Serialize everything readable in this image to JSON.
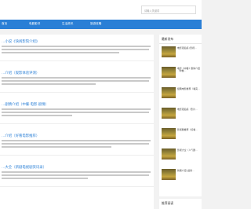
{
  "search": {
    "placeholder": "请输入关键词"
  },
  "nav": {
    "items": [
      "首页",
      "电影影评",
      "生活资讯",
      "旅游攻略"
    ]
  },
  "articles": [
    {
      "title": "…小说《快阅影院介绍》"
    },
    {
      "title": "…介绍（观影体验评测）"
    },
    {
      "title": "…剧情介绍（中餐·电影·剧情）"
    },
    {
      "title": "…介绍（好看电影推荐）"
    },
    {
      "title": "…大全（新剧电视剧资讯录）"
    }
  ],
  "sidebar": {
    "title": "最新发布",
    "items": [
      {
        "text": "电影观后感 (影视…"
      },
      {
        "text": "电影《中餐》剧情介绍（中餐…"
      },
      {
        "text": "经典电影推荐（看完…"
      },
      {
        "text": "电影观后感（影片…"
      },
      {
        "text": "影视剧推荐（好看…"
      },
      {
        "text": "影视大全（人气剧…"
      },
      {
        "text": "新剧介绍 (最新…"
      }
    ],
    "footer_title": "推荐阅读"
  }
}
